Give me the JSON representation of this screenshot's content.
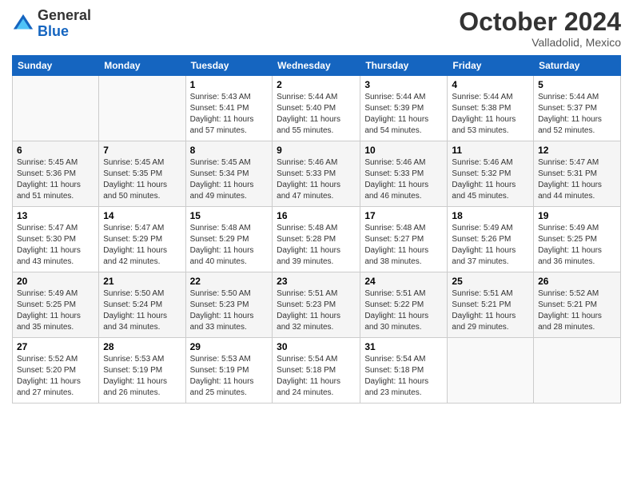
{
  "header": {
    "logo_general": "General",
    "logo_blue": "Blue",
    "month_title": "October 2024",
    "location": "Valladolid, Mexico"
  },
  "weekdays": [
    "Sunday",
    "Monday",
    "Tuesday",
    "Wednesday",
    "Thursday",
    "Friday",
    "Saturday"
  ],
  "weeks": [
    [
      {
        "day": "",
        "info": ""
      },
      {
        "day": "",
        "info": ""
      },
      {
        "day": "1",
        "info": "Sunrise: 5:43 AM\nSunset: 5:41 PM\nDaylight: 11 hours and 57 minutes."
      },
      {
        "day": "2",
        "info": "Sunrise: 5:44 AM\nSunset: 5:40 PM\nDaylight: 11 hours and 55 minutes."
      },
      {
        "day": "3",
        "info": "Sunrise: 5:44 AM\nSunset: 5:39 PM\nDaylight: 11 hours and 54 minutes."
      },
      {
        "day": "4",
        "info": "Sunrise: 5:44 AM\nSunset: 5:38 PM\nDaylight: 11 hours and 53 minutes."
      },
      {
        "day": "5",
        "info": "Sunrise: 5:44 AM\nSunset: 5:37 PM\nDaylight: 11 hours and 52 minutes."
      }
    ],
    [
      {
        "day": "6",
        "info": "Sunrise: 5:45 AM\nSunset: 5:36 PM\nDaylight: 11 hours and 51 minutes."
      },
      {
        "day": "7",
        "info": "Sunrise: 5:45 AM\nSunset: 5:35 PM\nDaylight: 11 hours and 50 minutes."
      },
      {
        "day": "8",
        "info": "Sunrise: 5:45 AM\nSunset: 5:34 PM\nDaylight: 11 hours and 49 minutes."
      },
      {
        "day": "9",
        "info": "Sunrise: 5:46 AM\nSunset: 5:33 PM\nDaylight: 11 hours and 47 minutes."
      },
      {
        "day": "10",
        "info": "Sunrise: 5:46 AM\nSunset: 5:33 PM\nDaylight: 11 hours and 46 minutes."
      },
      {
        "day": "11",
        "info": "Sunrise: 5:46 AM\nSunset: 5:32 PM\nDaylight: 11 hours and 45 minutes."
      },
      {
        "day": "12",
        "info": "Sunrise: 5:47 AM\nSunset: 5:31 PM\nDaylight: 11 hours and 44 minutes."
      }
    ],
    [
      {
        "day": "13",
        "info": "Sunrise: 5:47 AM\nSunset: 5:30 PM\nDaylight: 11 hours and 43 minutes."
      },
      {
        "day": "14",
        "info": "Sunrise: 5:47 AM\nSunset: 5:29 PM\nDaylight: 11 hours and 42 minutes."
      },
      {
        "day": "15",
        "info": "Sunrise: 5:48 AM\nSunset: 5:29 PM\nDaylight: 11 hours and 40 minutes."
      },
      {
        "day": "16",
        "info": "Sunrise: 5:48 AM\nSunset: 5:28 PM\nDaylight: 11 hours and 39 minutes."
      },
      {
        "day": "17",
        "info": "Sunrise: 5:48 AM\nSunset: 5:27 PM\nDaylight: 11 hours and 38 minutes."
      },
      {
        "day": "18",
        "info": "Sunrise: 5:49 AM\nSunset: 5:26 PM\nDaylight: 11 hours and 37 minutes."
      },
      {
        "day": "19",
        "info": "Sunrise: 5:49 AM\nSunset: 5:25 PM\nDaylight: 11 hours and 36 minutes."
      }
    ],
    [
      {
        "day": "20",
        "info": "Sunrise: 5:49 AM\nSunset: 5:25 PM\nDaylight: 11 hours and 35 minutes."
      },
      {
        "day": "21",
        "info": "Sunrise: 5:50 AM\nSunset: 5:24 PM\nDaylight: 11 hours and 34 minutes."
      },
      {
        "day": "22",
        "info": "Sunrise: 5:50 AM\nSunset: 5:23 PM\nDaylight: 11 hours and 33 minutes."
      },
      {
        "day": "23",
        "info": "Sunrise: 5:51 AM\nSunset: 5:23 PM\nDaylight: 11 hours and 32 minutes."
      },
      {
        "day": "24",
        "info": "Sunrise: 5:51 AM\nSunset: 5:22 PM\nDaylight: 11 hours and 30 minutes."
      },
      {
        "day": "25",
        "info": "Sunrise: 5:51 AM\nSunset: 5:21 PM\nDaylight: 11 hours and 29 minutes."
      },
      {
        "day": "26",
        "info": "Sunrise: 5:52 AM\nSunset: 5:21 PM\nDaylight: 11 hours and 28 minutes."
      }
    ],
    [
      {
        "day": "27",
        "info": "Sunrise: 5:52 AM\nSunset: 5:20 PM\nDaylight: 11 hours and 27 minutes."
      },
      {
        "day": "28",
        "info": "Sunrise: 5:53 AM\nSunset: 5:19 PM\nDaylight: 11 hours and 26 minutes."
      },
      {
        "day": "29",
        "info": "Sunrise: 5:53 AM\nSunset: 5:19 PM\nDaylight: 11 hours and 25 minutes."
      },
      {
        "day": "30",
        "info": "Sunrise: 5:54 AM\nSunset: 5:18 PM\nDaylight: 11 hours and 24 minutes."
      },
      {
        "day": "31",
        "info": "Sunrise: 5:54 AM\nSunset: 5:18 PM\nDaylight: 11 hours and 23 minutes."
      },
      {
        "day": "",
        "info": ""
      },
      {
        "day": "",
        "info": ""
      }
    ]
  ]
}
